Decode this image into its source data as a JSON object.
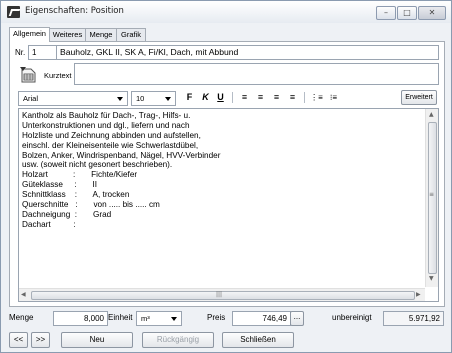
{
  "window": {
    "title": "Eigenschaften: Position",
    "minimize_glyph": "–",
    "maximize_glyph": "□",
    "close_glyph": "✕"
  },
  "tabs": [
    {
      "label": "Allgemein",
      "active": true
    },
    {
      "label": "Weiteres",
      "active": false
    },
    {
      "label": "Menge",
      "active": false
    },
    {
      "label": "Grafik",
      "active": false
    }
  ],
  "general": {
    "nr_label": "Nr.",
    "nr_value": "1",
    "short_title": "Bauholz, GKL II, SK A, Fi/Kl, Dach, mit Abbund",
    "kurztext_label": "Kurztext",
    "kurztext_value": ""
  },
  "format_toolbar": {
    "font": "Arial",
    "size": "10",
    "bold_glyph": "F",
    "italic_glyph": "K",
    "underline_glyph": "U",
    "align_left_glyph": "≡",
    "align_center_glyph": "≡",
    "align_right_glyph": "≡",
    "align_justify_glyph": "≡",
    "numbered_list_glyph": "⋮≡",
    "bullet_list_glyph": "⁝≡",
    "extended_label": "Erweitert"
  },
  "long_text": [
    "Kantholz als Bauholz für Dach-, Trag-, Hilfs- u.",
    "Unterkonstruktionen und dgl., liefern und nach",
    "Holzliste und Zeichnung abbinden und aufstellen,",
    "einschl. der Kleineisenteile wie Schwerlastdübel,",
    "Bolzen, Anker, Windrispenband, Nägel, HVV-Verbinder",
    "usw. (soweit nicht gesonert beschrieben).",
    "Holzart           :       Fichte/Kiefer",
    "Güteklasse     :       II",
    "Schnittklass    :       A, trocken",
    "Querschnitte   :       von ..... bis ..... cm",
    "Dachneigung  :       Grad",
    "Dachart          :"
  ],
  "scroll": {
    "up_glyph": "▲",
    "down_glyph": "▼",
    "left_glyph": "◀",
    "right_glyph": "▶",
    "grip": "|||",
    "vgrip": "≡"
  },
  "quantity": {
    "menge_label": "Menge",
    "menge_value": "8,000",
    "einheit_label": "Einheit",
    "einheit_value": "m³",
    "preis_label": "Preis",
    "preis_value": "746,49",
    "more_button": "...",
    "status_label": "unbereinigt",
    "total_value": "5.971,92"
  },
  "buttons": {
    "prev": "<<",
    "next": ">>",
    "neu": "Neu",
    "undo": "Rückgängig",
    "close": "Schließen"
  }
}
